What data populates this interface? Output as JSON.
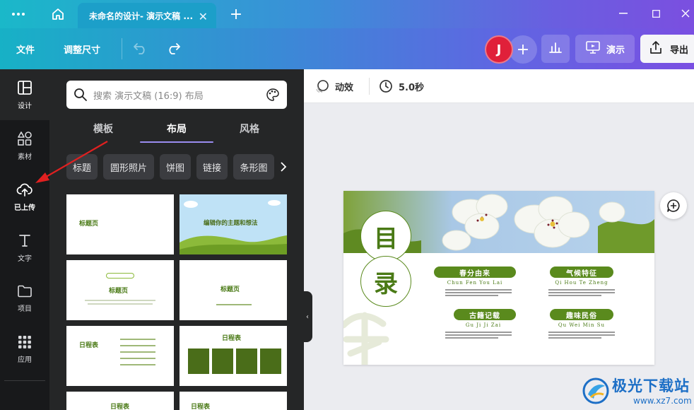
{
  "titlebar": {
    "tab_title": "未命名的设计- 演示文稿 ...",
    "icons": {
      "menu": "more-dots-icon",
      "home": "home-icon",
      "close_tab": "close-icon",
      "new_tab": "plus-icon"
    }
  },
  "toolbar": {
    "file_label": "文件",
    "resize_label": "调整尺寸",
    "avatar_initial": "J",
    "present_label": "演示",
    "export_label": "导出"
  },
  "rail": {
    "items": [
      {
        "label": "设计",
        "icon": "layout-icon"
      },
      {
        "label": "素材",
        "icon": "shapes-icon"
      },
      {
        "label": "已上传",
        "icon": "upload-cloud-icon"
      },
      {
        "label": "文字",
        "icon": "text-icon"
      },
      {
        "label": "项目",
        "icon": "folder-icon"
      },
      {
        "label": "应用",
        "icon": "apps-grid-icon"
      }
    ]
  },
  "panel": {
    "search_placeholder": "搜索 演示文稿 (16:9) 布局",
    "tabs": [
      "模板",
      "布局",
      "风格"
    ],
    "active_tab": "布局",
    "chips": [
      "标题",
      "圆形照片",
      "饼图",
      "链接",
      "条形图"
    ],
    "thumbs": {
      "t1": "标题页",
      "t2": "编辑你的主题和想法",
      "t3": "标题页",
      "t4": "标题页",
      "t5": "日程表",
      "t6": "日程表",
      "t7": "日程表",
      "t8": "日程表"
    }
  },
  "editor": {
    "animation_label": "动效",
    "duration_label": "5.0秒"
  },
  "slide": {
    "title_chars": [
      "目",
      "录"
    ],
    "sections": [
      {
        "title": "春分由来",
        "pinyin": "Chun Fen You Lai"
      },
      {
        "title": "气候特征",
        "pinyin": "Qi Hou Te Zheng"
      },
      {
        "title": "古籍记载",
        "pinyin": "Gu Ji Ji Zai"
      },
      {
        "title": "趣味民俗",
        "pinyin": "Qu Wei Min Su"
      }
    ],
    "accent_color": "#5a8a1d"
  },
  "watermark": {
    "name": "极光下载站",
    "url": "www.xz7.com"
  }
}
